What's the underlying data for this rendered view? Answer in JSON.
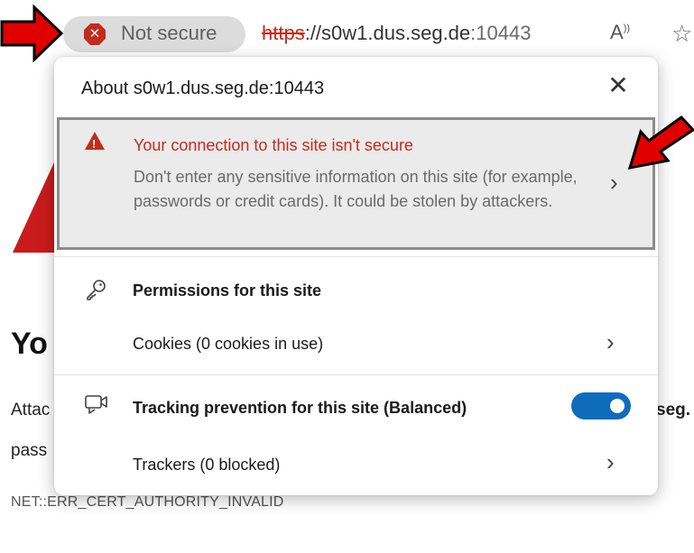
{
  "address_bar": {
    "security_label": "Not secure",
    "url_scheme": "https",
    "url_rest": "://s0w1.dus.seg.de",
    "url_port": ":10443",
    "read_aloud_icon": "read-aloud-icon",
    "favorites_icon": "favorites-star-icon"
  },
  "background_page": {
    "heading": "Yo",
    "line1": "Attac",
    "line1_right": "seg.",
    "line2": "pass",
    "error_code": "NET::ERR_CERT_AUTHORITY_INVALID"
  },
  "flyout": {
    "title": "About s0w1.dus.seg.de:10443",
    "close_icon": "close-icon",
    "warning": {
      "title": "Your connection to this site isn't secure",
      "body": "Don't enter any sensitive information on this site (for example, passwords or credit cards). It could be stolen by attackers.",
      "icon": "warning-triangle-icon"
    },
    "permissions": {
      "heading": "Permissions for this site",
      "icon": "key-icon",
      "cookies_label": "Cookies (0 cookies in use)"
    },
    "tracking": {
      "heading": "Tracking prevention for this site (Balanced)",
      "icon": "tracking-prevention-icon",
      "toggle_on": true,
      "trackers_label": "Trackers (0 blocked)"
    }
  },
  "colors": {
    "warning_red": "#c42b1c",
    "toggle_blue": "#0f6cbd",
    "annotation_arrow": "#e00000"
  }
}
